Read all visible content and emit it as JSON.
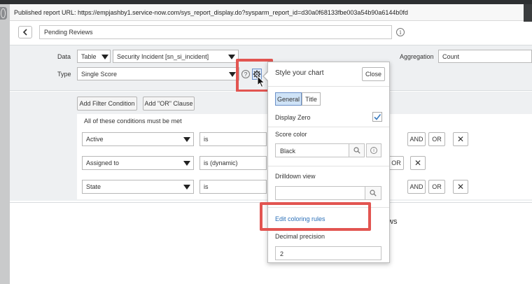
{
  "url_bar": {
    "text": "Published report URL: https://empjashby1.service-now.com/sys_report_display.do?sysparm_report_id=d30a0f68133fbe003a54b90a6144b0fd"
  },
  "report": {
    "title_value": "Pending Reviews"
  },
  "config": {
    "data_label": "Data",
    "data_source": "Table",
    "table_value": "Security Incident [sn_si_incident]",
    "type_label": "Type",
    "type_value": "Single Score",
    "help_glyph": "?",
    "aggregation_label": "Aggregation",
    "aggregation_value": "Count"
  },
  "filter": {
    "add_filter_label": "Add Filter Condition",
    "add_or_label": "Add \"OR\" Clause",
    "heading": "All of these conditions must be met",
    "rows": [
      {
        "field": "Active",
        "operator": "is"
      },
      {
        "field": "Assigned to",
        "operator": "is (dynamic)"
      },
      {
        "field": "State",
        "operator": "is"
      }
    ],
    "and_label": "AND",
    "or_label": "OR",
    "remove_glyph": "✕"
  },
  "lower": {
    "partial_text": "ws"
  },
  "style_panel": {
    "title": "Style your chart",
    "close_label": "Close",
    "tabs": [
      {
        "label": "General",
        "active": true
      },
      {
        "label": "Title",
        "active": false
      }
    ],
    "display_zero_label": "Display Zero",
    "display_zero_checked": true,
    "score_color_label": "Score color",
    "score_color_value": "Black",
    "drilldown_label": "Drilldown view",
    "drilldown_value": "",
    "edit_coloring_label": "Edit coloring rules",
    "decimal_label": "Decimal precision",
    "decimal_value": "2"
  },
  "colors": {
    "highlight": "#e25551",
    "link": "#2a6fb8",
    "active_tab": "#cfe3f7"
  }
}
